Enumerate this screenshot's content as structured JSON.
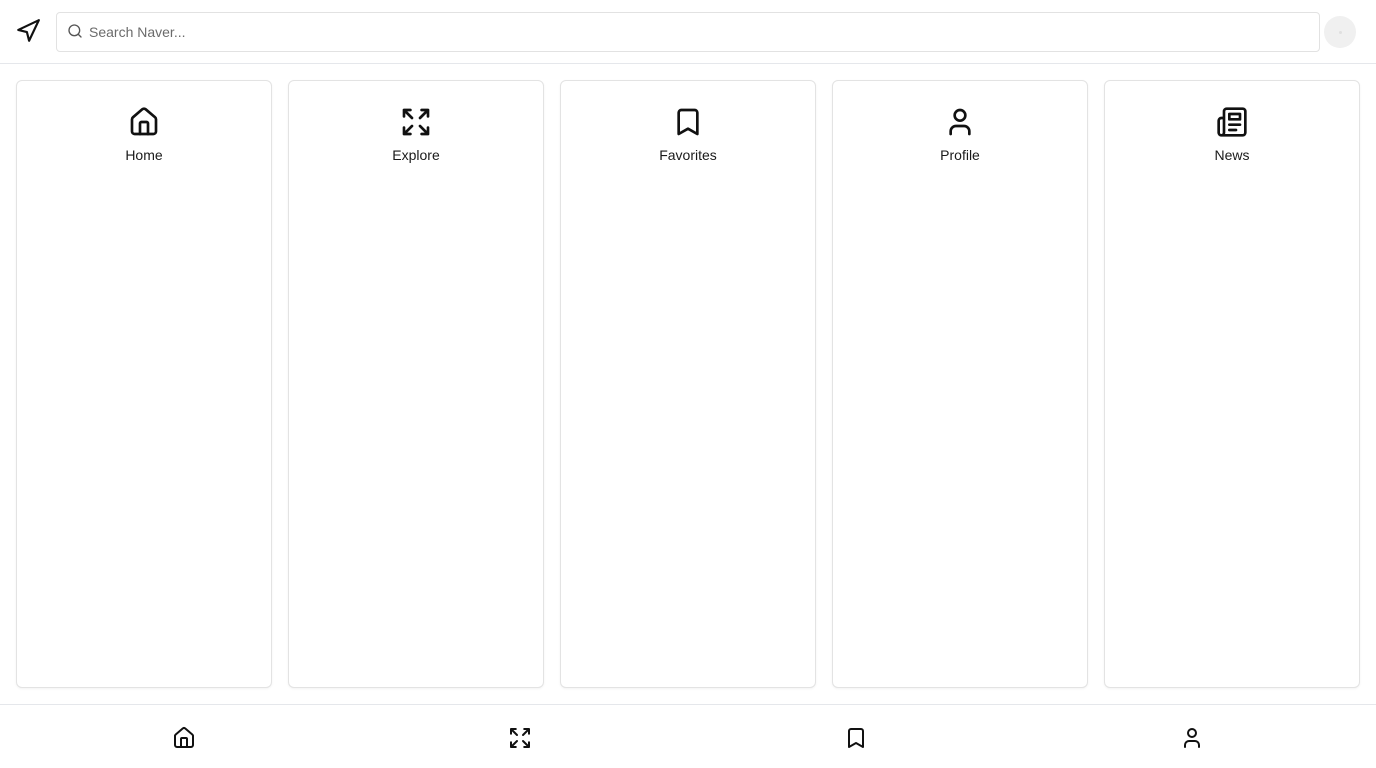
{
  "header": {
    "nav_icon": "navigation-arrow-icon",
    "search": {
      "placeholder": "Search Naver...",
      "value": "",
      "icon": "search-icon"
    },
    "avatar": "avatar"
  },
  "cards": [
    {
      "label": "Home",
      "icon": "home-icon"
    },
    {
      "label": "Explore",
      "icon": "expand-icon"
    },
    {
      "label": "Favorites",
      "icon": "bookmark-icon"
    },
    {
      "label": "Profile",
      "icon": "user-icon"
    },
    {
      "label": "News",
      "icon": "newspaper-icon"
    }
  ],
  "bottom_nav": [
    {
      "icon": "home-icon"
    },
    {
      "icon": "expand-icon"
    },
    {
      "icon": "bookmark-icon"
    },
    {
      "icon": "user-icon"
    }
  ],
  "colors": {
    "border": "#e5e7eb",
    "text": "#111111",
    "placeholder": "#6b6b6b",
    "avatar_bg": "#f0f0f0"
  }
}
